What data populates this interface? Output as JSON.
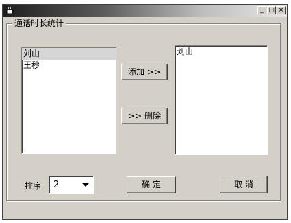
{
  "window": {
    "title_buttons": {
      "minimize": "_",
      "maximize": "□",
      "close": "×"
    },
    "icon": "java-cup-icon"
  },
  "group": {
    "title": "通话时长统计"
  },
  "left_list": {
    "items": [
      "刘山",
      "王秒"
    ],
    "selected_index": 0
  },
  "right_list": {
    "items": [
      "刘山"
    ]
  },
  "buttons": {
    "add": "添加 >>",
    "remove": ">> 删除",
    "ok": "确 定",
    "cancel": "取 消"
  },
  "sort": {
    "label": "排序",
    "value": "2"
  }
}
